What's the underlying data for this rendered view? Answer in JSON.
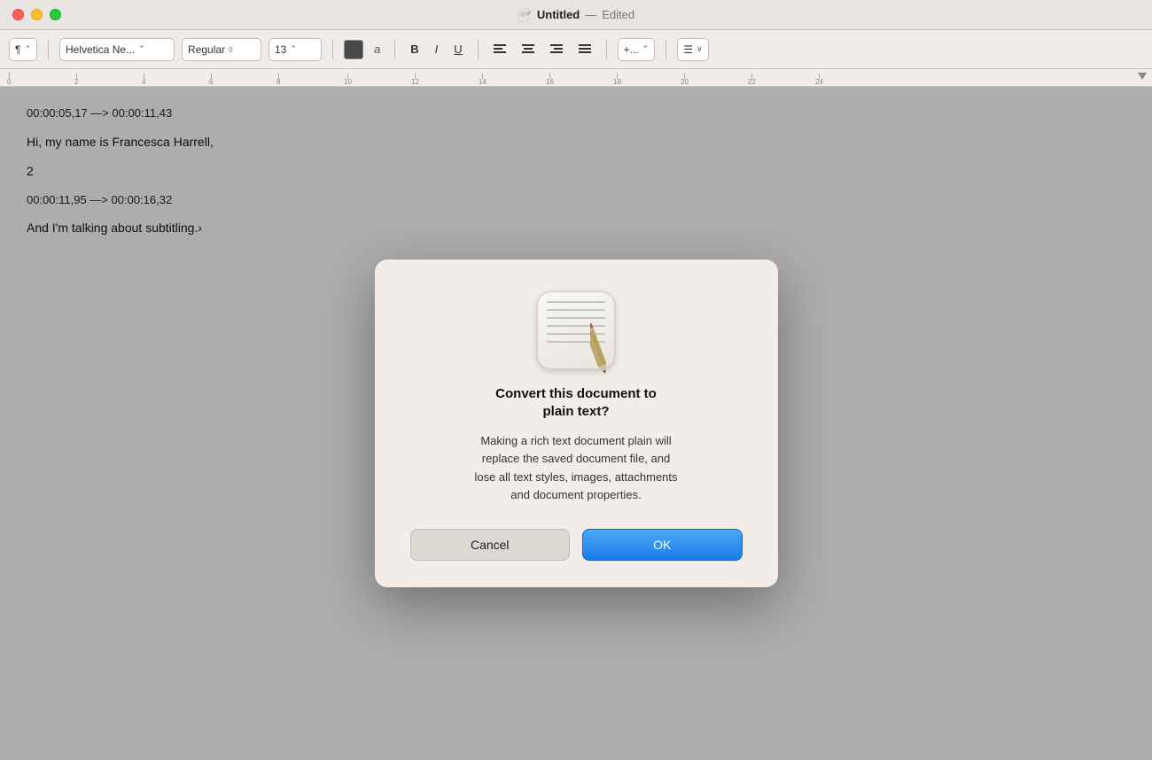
{
  "titleBar": {
    "appTitle": "Untitled",
    "separator": "—",
    "editedLabel": "Edited"
  },
  "toolbar": {
    "paragraph": "¶",
    "paragraphChevron": "⌃",
    "font": "Helvetica Ne...",
    "fontChevron": "⌃",
    "style": "Regular",
    "styleChevron": "◊",
    "size": "13",
    "sizeChevron": "⌃",
    "fontChar": "a",
    "bold": "B",
    "italic": "I",
    "underline": "U",
    "alignLeft": "≡",
    "alignCenter": "≡",
    "alignRight": "≡",
    "alignJustify": "≡",
    "more": "+...",
    "moreChevron": "⌃",
    "list": "☰"
  },
  "ruler": {
    "marks": [
      "0",
      "2",
      "4",
      "6",
      "8",
      "10",
      "12",
      "14",
      "16",
      "18",
      "20",
      "22",
      "24"
    ]
  },
  "document": {
    "line1": "00:00:05,17 —> 00:00:11,43",
    "line2": "Hi, my name is Francesca Harrell,",
    "line3": "2",
    "line4": "00:00:11,95 —> 00:00:16,32",
    "line5": "And I'm talking about subtitling.›"
  },
  "modal": {
    "title": "Convert this document to\nplain text?",
    "body": "Making a rich text document plain will\nreplace the saved document file, and\nlose all text styles, images, attachments\nand document properties.",
    "cancelLabel": "Cancel",
    "okLabel": "OK"
  }
}
